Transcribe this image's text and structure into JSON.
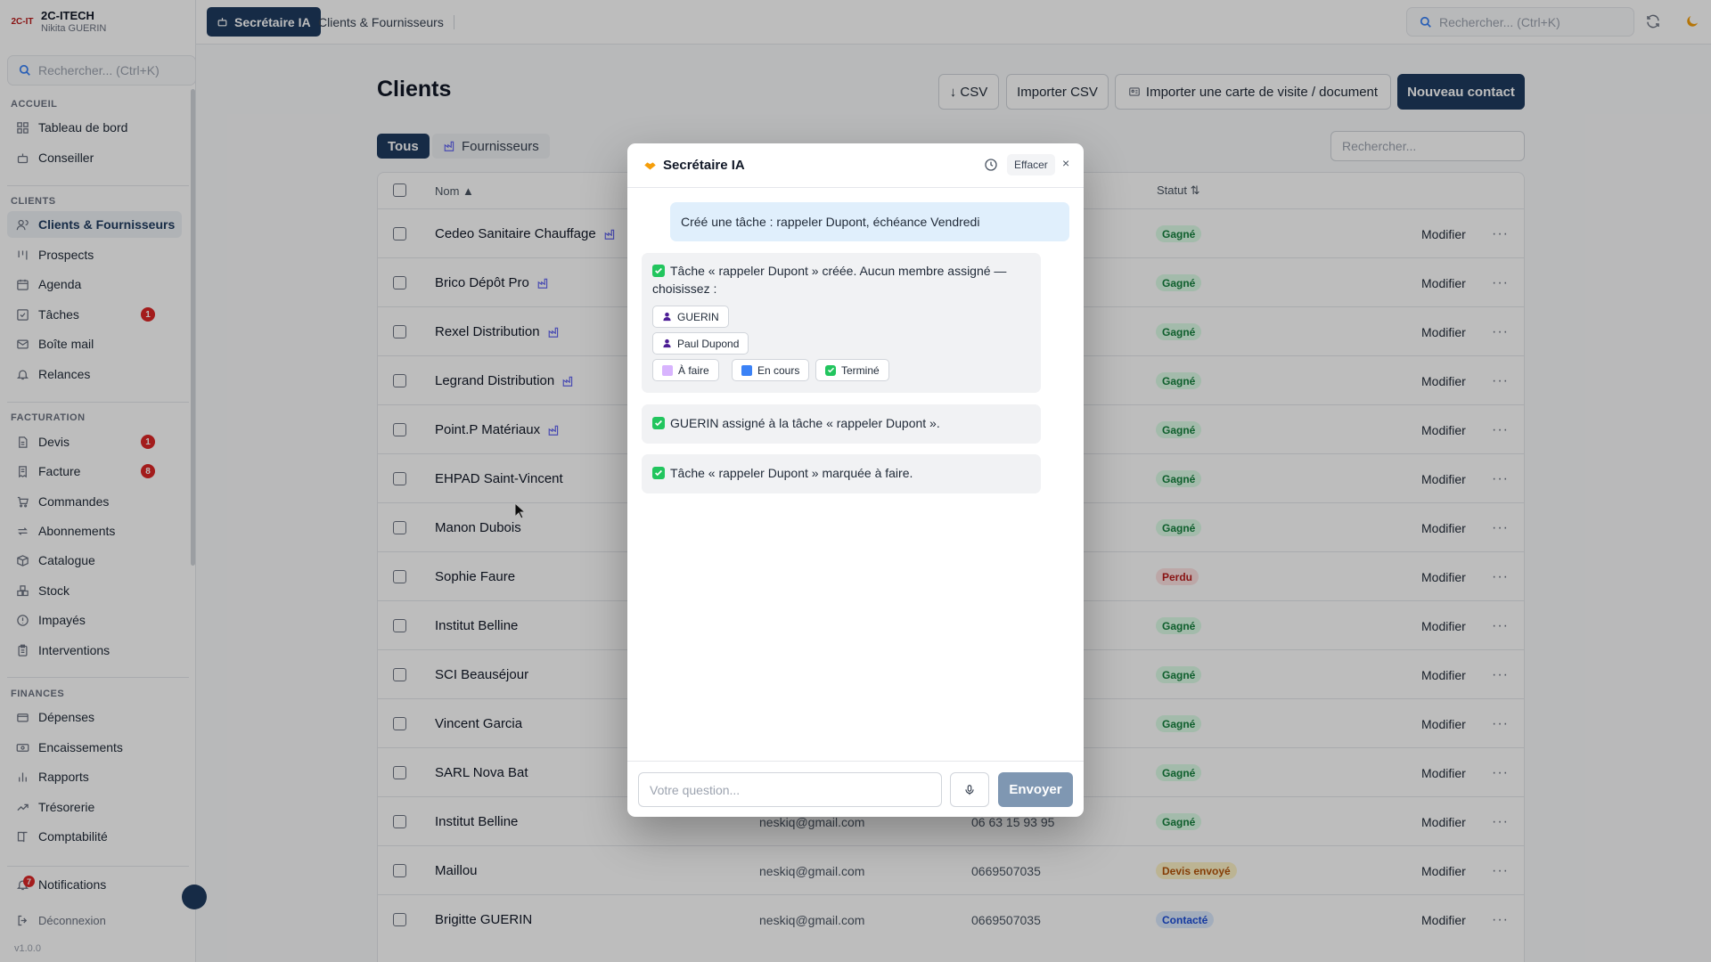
{
  "sidebar": {
    "brand_logo": "2C-IT",
    "brand_name": "2C-ITECH",
    "user_name": "Nikita GUERIN",
    "search_placeholder": "Rechercher... (Ctrl+K)",
    "sections": {
      "accueil": "ACCUEIL",
      "clients": "CLIENTS",
      "facturation": "FACTURATION",
      "finances": "FINANCES"
    },
    "items": [
      {
        "label": "Tableau de bord",
        "icon": "dashboard-icon"
      },
      {
        "label": "Conseiller",
        "icon": "bot-icon"
      },
      {
        "label": "Clients & Fournisseurs",
        "icon": "users-icon",
        "active": true
      },
      {
        "label": "Prospects",
        "icon": "kanban-icon"
      },
      {
        "label": "Agenda",
        "icon": "calendar-icon"
      },
      {
        "label": "Tâches",
        "icon": "task-icon",
        "badge": "1"
      },
      {
        "label": "Boîte mail",
        "icon": "mail-icon"
      },
      {
        "label": "Relances",
        "icon": "bell-icon"
      },
      {
        "label": "Devis",
        "icon": "document-icon",
        "badge": "1"
      },
      {
        "label": "Facture",
        "icon": "invoice-icon",
        "badge": "8"
      },
      {
        "label": "Commandes",
        "icon": "cart-icon"
      },
      {
        "label": "Abonnements",
        "icon": "repeat-icon"
      },
      {
        "label": "Catalogue",
        "icon": "box-icon"
      },
      {
        "label": "Stock",
        "icon": "boxes-icon"
      },
      {
        "label": "Impayés",
        "icon": "alert-circle-icon"
      },
      {
        "label": "Interventions",
        "icon": "clipboard-icon"
      },
      {
        "label": "Dépenses",
        "icon": "wallet-icon"
      },
      {
        "label": "Encaissements",
        "icon": "banknote-icon"
      },
      {
        "label": "Rapports",
        "icon": "bar-chart-icon"
      },
      {
        "label": "Trésorerie",
        "icon": "trend-icon"
      },
      {
        "label": "Comptabilité",
        "icon": "book-icon"
      }
    ],
    "notifications_label": "Notifications",
    "notifications_count": "7",
    "logout_label": "Déconnexion",
    "version": "v1.0.0"
  },
  "topbar": {
    "active_tab": "Secrétaire IA",
    "tab2": "Clients & Fournisseurs",
    "search_placeholder": "Rechercher... (Ctrl+K)"
  },
  "main": {
    "title": "Clients",
    "buttons": {
      "csv": "↓ CSV",
      "import_csv": "Importer CSV",
      "import_card": "Importer une carte de visite / document",
      "new_contact": "Nouveau contact"
    },
    "filters": {
      "all": "Tous",
      "suppliers": "Fournisseurs"
    },
    "search_placeholder": "Rechercher...",
    "columns": {
      "name": "Nom ▲",
      "status": "Statut ⇅"
    },
    "rows": [
      {
        "name": "Cedeo Sanitaire Chauffage",
        "supplier": true,
        "email": "",
        "phone": "",
        "status": "Gagné",
        "kind": "win"
      },
      {
        "name": "Brico Dépôt Pro",
        "supplier": true,
        "email": "",
        "phone": "",
        "status": "Gagné",
        "kind": "win"
      },
      {
        "name": "Rexel Distribution",
        "supplier": true,
        "email": "",
        "phone": "",
        "status": "Gagné",
        "kind": "win"
      },
      {
        "name": "Legrand Distribution",
        "supplier": true,
        "email": "",
        "phone": "",
        "status": "Gagné",
        "kind": "win"
      },
      {
        "name": "Point.P Matériaux",
        "supplier": true,
        "email": "",
        "phone": "",
        "status": "Gagné",
        "kind": "win"
      },
      {
        "name": "EHPAD Saint-Vincent",
        "supplier": false,
        "email": "",
        "phone": "",
        "status": "Gagné",
        "kind": "win"
      },
      {
        "name": "Manon Dubois",
        "supplier": false,
        "email": "",
        "phone": "",
        "status": "Gagné",
        "kind": "win"
      },
      {
        "name": "Sophie Faure",
        "supplier": false,
        "email": "",
        "phone": "",
        "status": "Perdu",
        "kind": "lose"
      },
      {
        "name": "Institut Belline",
        "supplier": false,
        "email": "",
        "phone": "",
        "status": "Gagné",
        "kind": "win"
      },
      {
        "name": "SCI Beauséjour",
        "supplier": false,
        "email": "",
        "phone": "",
        "status": "Gagné",
        "kind": "win"
      },
      {
        "name": "Vincent Garcia",
        "supplier": false,
        "email": "",
        "phone": "",
        "status": "Gagné",
        "kind": "win"
      },
      {
        "name": "SARL Nova Bat",
        "supplier": false,
        "email": "",
        "phone": "",
        "status": "Gagné",
        "kind": "win"
      },
      {
        "name": "Institut Belline",
        "supplier": false,
        "email": "neskiq@gmail.com",
        "phone": "06 63 15 93 95",
        "status": "Gagné",
        "kind": "win"
      },
      {
        "name": "Maillou",
        "supplier": false,
        "email": "neskiq@gmail.com",
        "phone": "0669507035",
        "status": "Devis envoyé",
        "kind": "sent"
      },
      {
        "name": "Brigitte GUERIN",
        "supplier": false,
        "email": "neskiq@gmail.com",
        "phone": "0669507035",
        "status": "Contacté",
        "kind": "contact"
      }
    ],
    "edit_label": "Modifier",
    "more_label": "···"
  },
  "modal": {
    "title": "Secrétaire IA",
    "clear_label": "Effacer",
    "close_label": "×",
    "user_message": "Créé une tâche : rappeler Dupont, échéance Vendredi",
    "bot_msg1_line1": "Tâche « rappeler Dupont » créée. Aucun membre assigné —",
    "bot_msg1_line2": "choisissez :",
    "assignee1": "GUERIN",
    "assignee2": "Paul Dupond",
    "status_todo": "À faire",
    "status_progress": "En cours",
    "status_done": "Terminé",
    "bot_msg2": "GUERIN assigné à la tâche « rappeler Dupont ».",
    "bot_msg3": "Tâche « rappeler Dupont » marquée à faire.",
    "input_placeholder": "Votre question...",
    "send_label": "Envoyer"
  },
  "colors": {
    "primary": "#1e3a5f",
    "success_bg": "#dcfce7",
    "success_fg": "#15803d",
    "danger": "#dc2626",
    "user_bubble": "#e0effc",
    "bot_bubble": "#f1f2f4"
  }
}
